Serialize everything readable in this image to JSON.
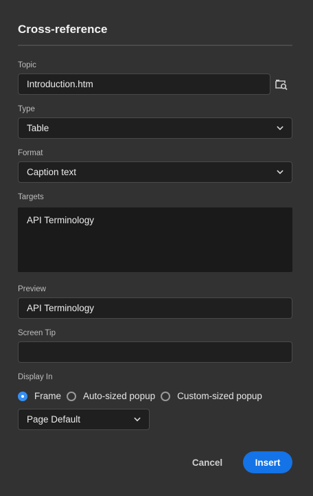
{
  "dialog": {
    "title": "Cross-reference"
  },
  "topic": {
    "label": "Topic",
    "value": "Introduction.htm",
    "browse_icon": "browse-folder-search-icon"
  },
  "type": {
    "label": "Type",
    "selected": "Table"
  },
  "format": {
    "label": "Format",
    "selected": "Caption text"
  },
  "targets": {
    "label": "Targets",
    "items": [
      "API Terminology"
    ]
  },
  "preview": {
    "label": "Preview",
    "value": "API Terminology"
  },
  "screen_tip": {
    "label": "Screen Tip",
    "value": ""
  },
  "display_in": {
    "label": "Display In",
    "options": [
      "Frame",
      "Auto-sized popup",
      "Custom-sized popup"
    ],
    "selected_option": "Frame",
    "frame_select": "Page Default"
  },
  "buttons": {
    "cancel": "Cancel",
    "insert": "Insert"
  },
  "colors": {
    "accent": "#1473e6",
    "radio_checked": "#378ef0",
    "background": "#323232",
    "field": "#1f1f1f"
  }
}
